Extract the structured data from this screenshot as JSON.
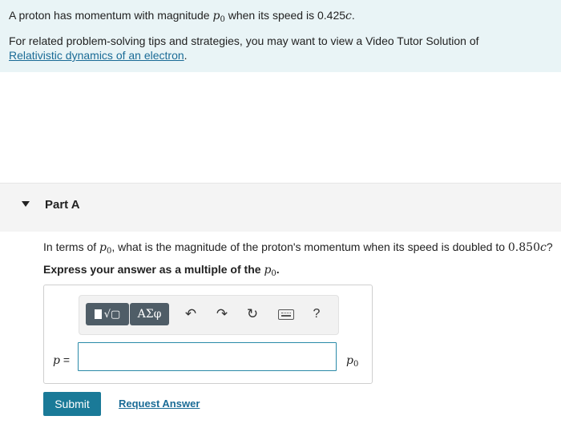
{
  "intro": {
    "line1_pre": "A proton has momentum with magnitude ",
    "line1_var": "p",
    "line1_sub": "0",
    "line1_post": " when its speed is 0.425",
    "line1_c": "c",
    "line1_end": ".",
    "line2": "For related problem-solving tips and strategies, you may want to view a Video Tutor Solution of",
    "link": "Relativistic dynamics of an electron",
    "link_end": "."
  },
  "part": {
    "title": "Part A"
  },
  "question": {
    "pre": "In terms of ",
    "var": "p",
    "sub": "0",
    "mid": ", what is the magnitude of the proton's momentum when its speed is doubled to ",
    "speed": "0.850",
    "c": "c",
    "end": "?"
  },
  "instruction": {
    "pre": "Express your answer as a multiple of the ",
    "var": "p",
    "sub": "0",
    "end": "."
  },
  "toolbar": {
    "templates_label": "√▢",
    "symbols_label": "ΑΣφ",
    "undo_icon": "↶",
    "redo_icon": "↷",
    "reset_icon": "↻",
    "help_label": "?"
  },
  "answer": {
    "label_var": "p",
    "label_eq": " =",
    "value": "",
    "unit_var": "p",
    "unit_sub": "0"
  },
  "actions": {
    "submit": "Submit",
    "request": "Request Answer"
  }
}
